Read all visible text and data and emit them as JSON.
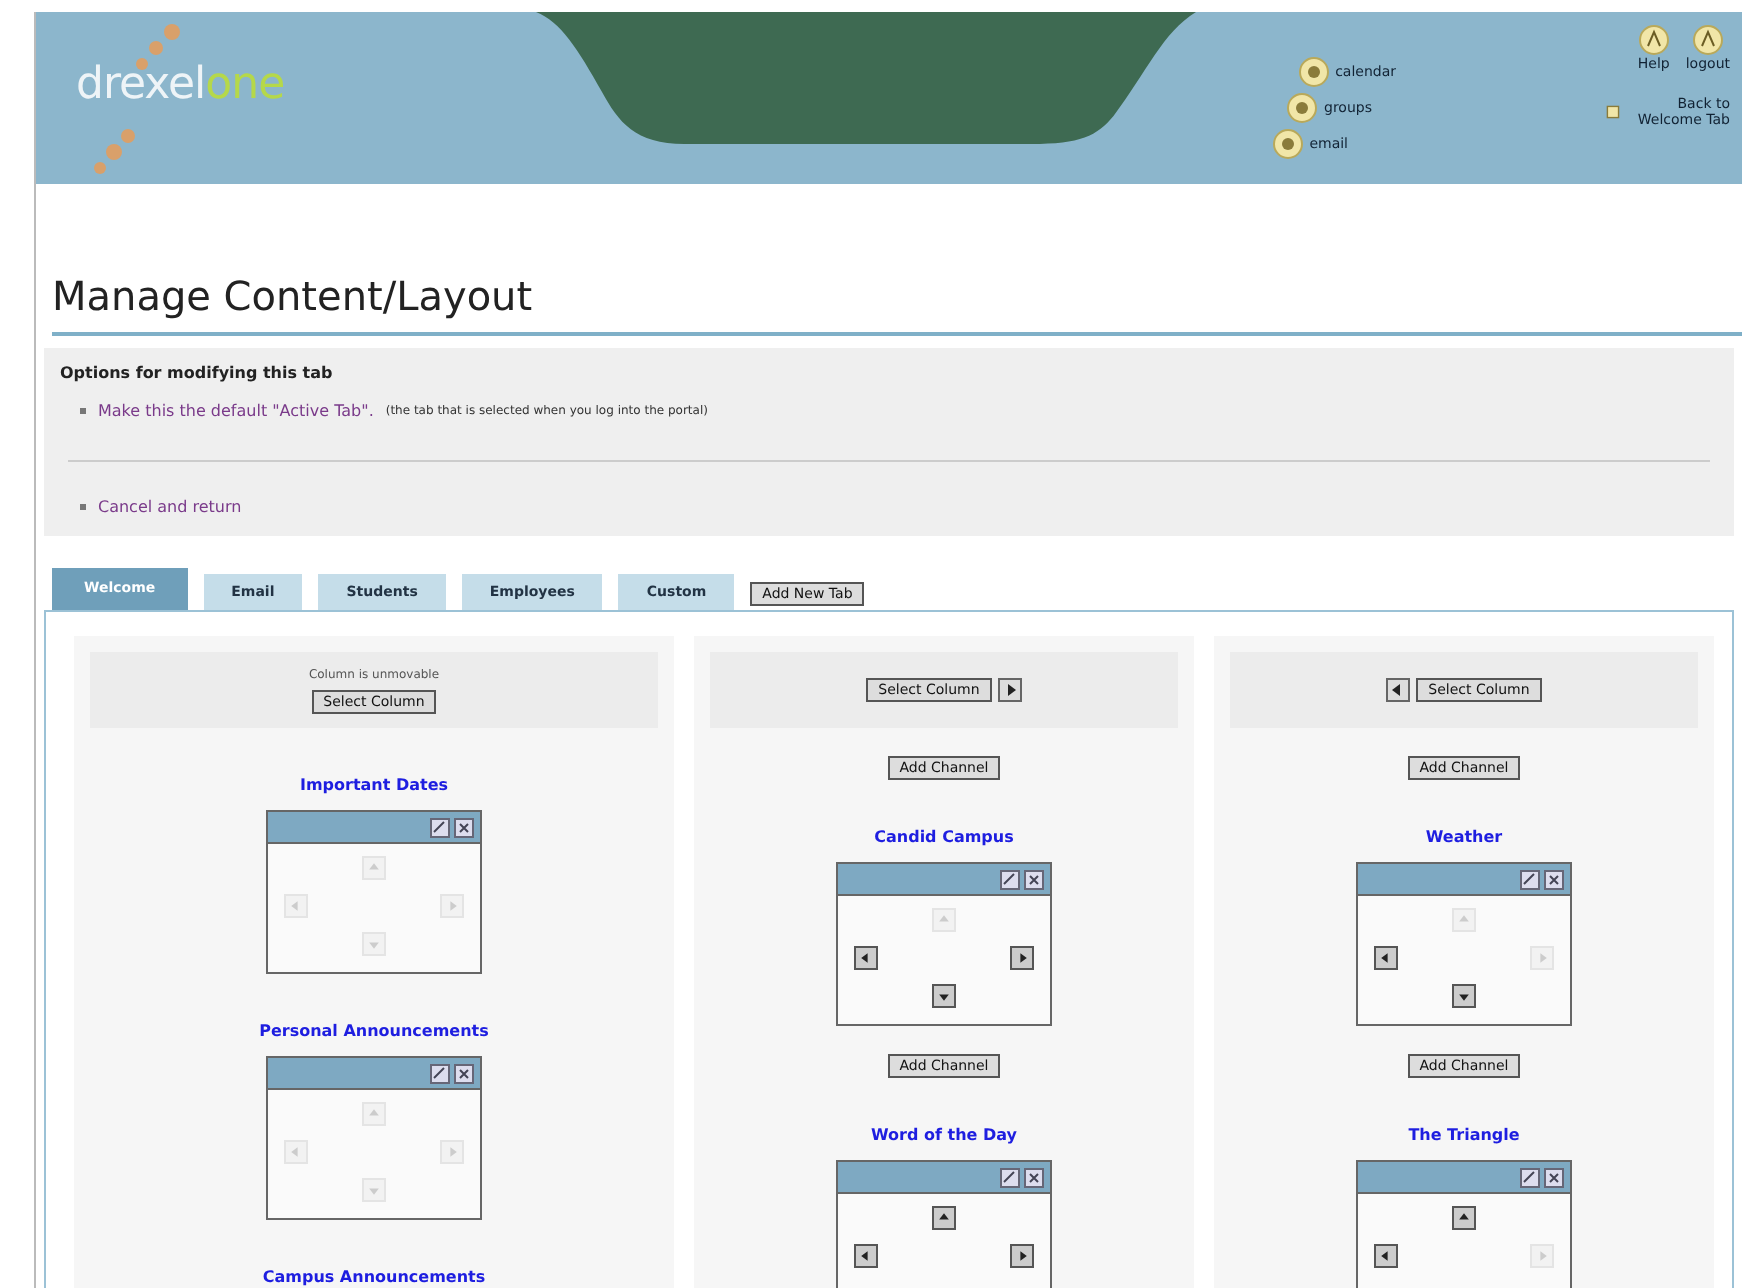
{
  "header": {
    "logo": {
      "part_1": "drexel",
      "part_2": "one"
    },
    "quick_links": [
      {
        "label": "calendar"
      },
      {
        "label": "groups"
      },
      {
        "label": "email"
      }
    ],
    "utility_links": [
      {
        "label": "Help"
      },
      {
        "label": "logout"
      }
    ],
    "back_link": "Back to Welcome Tab"
  },
  "page_title": "Manage Content/Layout",
  "options": {
    "heading": "Options for modifying this tab",
    "links": [
      {
        "label": "Make this the default \"Active Tab\".",
        "note": "(the tab that is selected when you log into the portal)"
      },
      {
        "label": "Cancel and return"
      }
    ]
  },
  "tabs": [
    {
      "label": "Welcome",
      "selected": true
    },
    {
      "label": "Email",
      "selected": false
    },
    {
      "label": "Students",
      "selected": false
    },
    {
      "label": "Employees",
      "selected": false
    },
    {
      "label": "Custom",
      "selected": false
    }
  ],
  "add_tab_button": "Add New Tab",
  "columns": [
    {
      "note": "Column is unmovable",
      "select_label": "Select Column",
      "move_left": false,
      "move_right": false,
      "items": [
        {
          "kind": "channel",
          "title": "Important Dates",
          "up": false,
          "left": false,
          "right": false,
          "down": false
        },
        {
          "kind": "channel",
          "title": "Personal Announcements",
          "up": false,
          "left": false,
          "right": false,
          "down": false
        },
        {
          "kind": "channel",
          "title": "Campus Announcements"
        }
      ]
    },
    {
      "select_label": "Select Column",
      "move_left": false,
      "move_right": true,
      "items": [
        {
          "kind": "add_button",
          "label": "Add Channel"
        },
        {
          "kind": "channel",
          "title": "Candid Campus",
          "up": false,
          "left": true,
          "right": true,
          "down": true
        },
        {
          "kind": "add_button",
          "label": "Add Channel"
        },
        {
          "kind": "channel",
          "title": "Word of the Day",
          "up": true,
          "left": true,
          "right": true
        }
      ]
    },
    {
      "select_label": "Select Column",
      "move_left": true,
      "move_right": false,
      "items": [
        {
          "kind": "add_button",
          "label": "Add Channel"
        },
        {
          "kind": "channel",
          "title": "Weather",
          "up": false,
          "left": true,
          "right": false,
          "down": true
        },
        {
          "kind": "add_button",
          "label": "Add Channel"
        },
        {
          "kind": "channel",
          "title": "The Triangle",
          "up": true,
          "left": true,
          "right": false
        }
      ]
    }
  ]
}
